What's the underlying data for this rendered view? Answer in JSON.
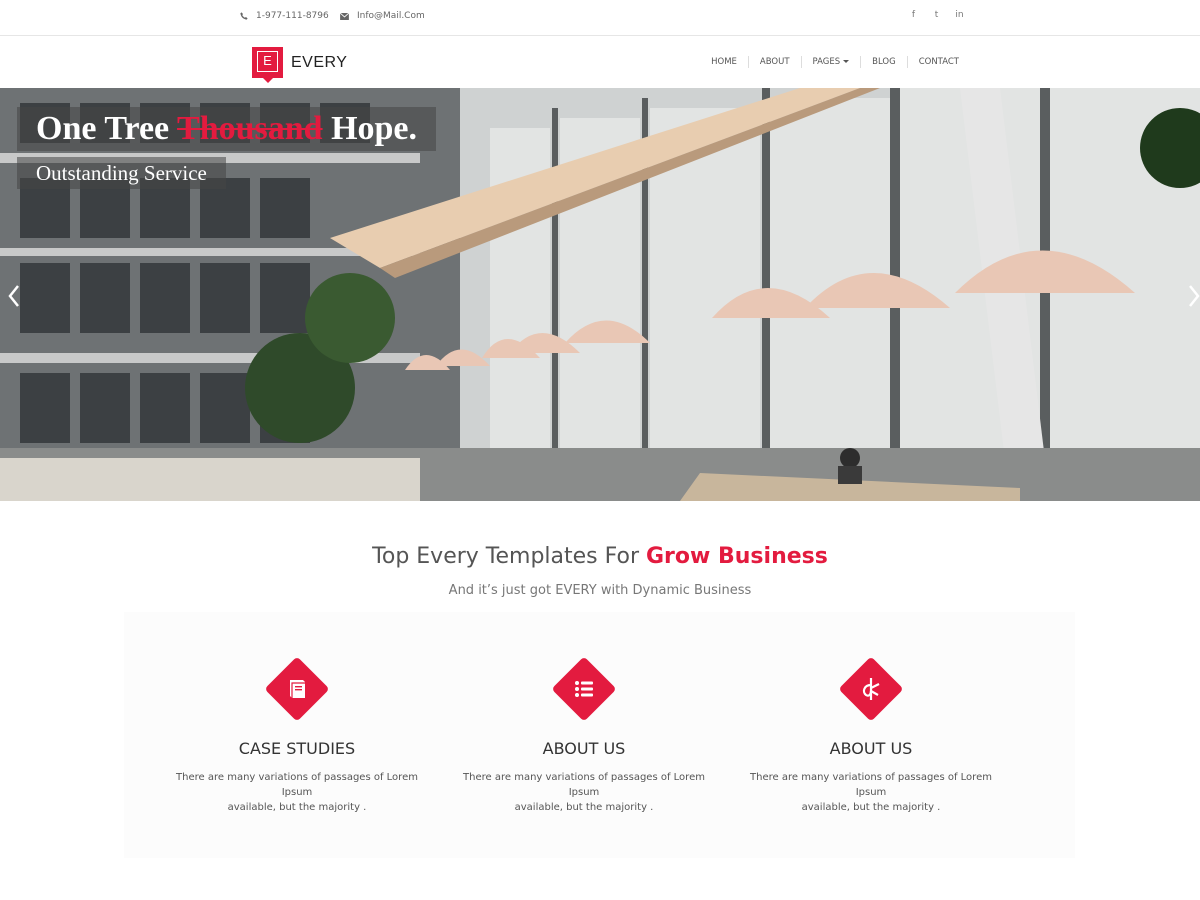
{
  "topbar": {
    "phone": "1-977-111-8796",
    "email": "Info@Mail.Com",
    "social": [
      {
        "icon": "facebook-icon",
        "glyph": "f"
      },
      {
        "icon": "twitter-icon",
        "glyph": "t"
      },
      {
        "icon": "linkedin-icon",
        "glyph": "in"
      }
    ]
  },
  "brand": {
    "letter": "E",
    "name": "EVERY"
  },
  "nav": {
    "items": [
      "HOME",
      "ABOUT",
      "PAGES",
      "BLOG",
      "CONTACT"
    ]
  },
  "hero": {
    "title_before": "One Tree ",
    "title_accent": "Thousand",
    "title_after": " Hope.",
    "subtitle": "Outstanding Service"
  },
  "intro": {
    "title_plain": "Top Every Templates For ",
    "title_accent": "Grow Business",
    "subtitle": "And it’s just got EVERY with Dynamic Business"
  },
  "features": [
    {
      "icon": "book-icon",
      "title": "CASE STUDIES",
      "text_line1": "There are many variations of passages of Lorem Ipsum",
      "text_line2": "available, but the majority ."
    },
    {
      "icon": "list-icon",
      "title": "ABOUT US",
      "text_line1": "There are many variations of passages of Lorem Ipsum",
      "text_line2": "available, but the majority ."
    },
    {
      "icon": "opencart-icon",
      "title": "ABOUT US",
      "text_line1": "There are many variations of passages of Lorem Ipsum",
      "text_line2": "available, but the majority ."
    }
  ],
  "colors": {
    "accent": "#e31b3f",
    "text": "#444444"
  }
}
